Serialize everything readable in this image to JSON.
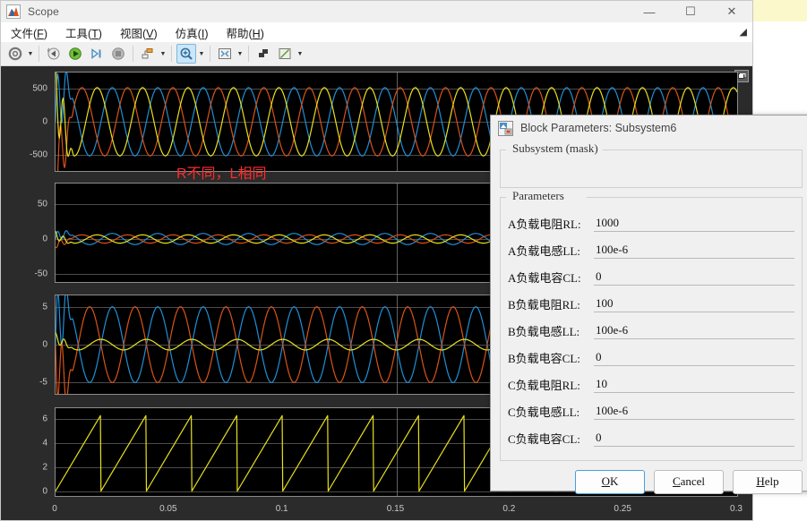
{
  "window": {
    "title": "Scope",
    "icon": "scope-icon",
    "controls": {
      "minimize": "—",
      "maximize": "☐",
      "close": "✕"
    }
  },
  "menubar": {
    "items": [
      {
        "name": "file",
        "text": "文件(F)",
        "pre": "文件(",
        "mnemonic": "F",
        "post": ")"
      },
      {
        "name": "tools",
        "text": "工具(T)",
        "pre": "工具(",
        "mnemonic": "T",
        "post": ")"
      },
      {
        "name": "view",
        "text": "视图(V)",
        "pre": "视图(",
        "mnemonic": "V",
        "post": ")"
      },
      {
        "name": "simulation",
        "text": "仿真(I)",
        "pre": "仿真(",
        "mnemonic": "I",
        "post": ")"
      },
      {
        "name": "help",
        "text": "帮助(H)",
        "pre": "帮助(",
        "mnemonic": "H",
        "post": ")"
      }
    ],
    "overflow": "◢"
  },
  "toolbar": {
    "buttons": [
      {
        "name": "configuration-properties-icon",
        "glyph": "gear",
        "dropdown": true,
        "active": false
      },
      {
        "name": "run-back-icon",
        "glyph": "runback",
        "dropdown": false,
        "active": false
      },
      {
        "name": "run-icon",
        "glyph": "play",
        "dropdown": false,
        "active": false
      },
      {
        "name": "step-forward-icon",
        "glyph": "step",
        "dropdown": false,
        "active": false
      },
      {
        "name": "stop-icon",
        "glyph": "stop",
        "dropdown": false,
        "active": false
      },
      {
        "name": "layout-icon",
        "glyph": "layout",
        "dropdown": true,
        "active": false
      },
      {
        "name": "zoom-in-icon",
        "glyph": "zoomin",
        "dropdown": true,
        "active": true
      },
      {
        "name": "fit-to-view-icon",
        "glyph": "fit",
        "dropdown": true,
        "active": false
      },
      {
        "name": "trigger-icon",
        "glyph": "trigger",
        "dropdown": false,
        "active": false
      },
      {
        "name": "measurements-icon",
        "glyph": "measure",
        "dropdown": true,
        "active": false
      }
    ]
  },
  "chart_data": {
    "type": "line",
    "title": "",
    "xlabel": "",
    "x_ticks": [
      "0",
      "0.05",
      "0.1",
      "0.15",
      "0.2",
      "0.25",
      "0.3"
    ],
    "xlim": [
      0,
      0.3
    ],
    "grid": true,
    "legend": "none",
    "series_colors": {
      "phase_a": "#1f8fd6",
      "phase_b": "#d95319",
      "phase_c": "#e8e01f"
    },
    "subplots": [
      {
        "name": "subplot-voltage",
        "ylabel": "",
        "y_ticks": [
          "500",
          "0",
          "-500"
        ],
        "ylim": [
          -750,
          750
        ],
        "series": [
          {
            "name": "phase_a",
            "color": "#1f8fd6",
            "amplitude": 520,
            "phase_deg": 0,
            "freq_hz": 50
          },
          {
            "name": "phase_b",
            "color": "#d95319",
            "amplitude": 520,
            "phase_deg": -120,
            "freq_hz": 50
          },
          {
            "name": "phase_c",
            "color": "#e8e01f",
            "amplitude": 520,
            "phase_deg": 120,
            "freq_hz": 50
          }
        ]
      },
      {
        "name": "subplot-current-small",
        "ylabel": "",
        "y_ticks": [
          "50",
          "0",
          "-50"
        ],
        "ylim": [
          -62,
          80
        ],
        "series": [
          {
            "name": "phase_a",
            "color": "#1f8fd6",
            "amplitude": 8,
            "phase_deg": 0,
            "freq_hz": 50
          },
          {
            "name": "phase_b",
            "color": "#d95319",
            "amplitude": 6,
            "phase_deg": -120,
            "freq_hz": 50
          },
          {
            "name": "phase_c",
            "color": "#e8e01f",
            "amplitude": 6,
            "phase_deg": 120,
            "freq_hz": 50
          }
        ]
      },
      {
        "name": "subplot-current-large",
        "ylabel": "",
        "y_ticks": [
          "5",
          "0",
          "-5"
        ],
        "ylim": [
          -6.5,
          6.5
        ],
        "series": [
          {
            "name": "phase_a",
            "color": "#1f8fd6",
            "amplitude": 5,
            "phase_deg": 0,
            "freq_hz": 50
          },
          {
            "name": "phase_b",
            "color": "#d95319",
            "amplitude": 5,
            "phase_deg": 180,
            "freq_hz": 50
          },
          {
            "name": "phase_c",
            "color": "#e8e01f",
            "amplitude": 0.7,
            "phase_deg": 90,
            "freq_hz": 50
          }
        ]
      },
      {
        "name": "subplot-sawtooth",
        "ylabel": "",
        "y_ticks": [
          "6",
          "4",
          "2",
          "0"
        ],
        "ylim": [
          -0.4,
          6.9
        ],
        "series": [
          {
            "name": "ramp",
            "color": "#e8e01f",
            "waveform": "sawtooth",
            "peak": 6.283,
            "period_s": 0.02
          }
        ]
      }
    ]
  },
  "dialog": {
    "icon": "block-parameters-icon",
    "title": "Block Parameters: Subsystem6",
    "mask_group_label": "Subsystem  (mask)",
    "params_group_label": "Parameters",
    "params": [
      {
        "name": "a-load-resistance",
        "label": "A负载电阻RL:",
        "value": "1000"
      },
      {
        "name": "a-load-inductance",
        "label": "A负载电感LL:",
        "value": "100e-6"
      },
      {
        "name": "a-load-capacitance",
        "label": "A负载电容CL:",
        "value": "0"
      },
      {
        "name": "b-load-resistance",
        "label": "B负载电阻RL:",
        "value": "100"
      },
      {
        "name": "b-load-inductance",
        "label": "B负载电感LL:",
        "value": "100e-6"
      },
      {
        "name": "b-load-capacitance",
        "label": "B负载电容CL:",
        "value": "0"
      },
      {
        "name": "c-load-resistance",
        "label": "C负载电阻RL:",
        "value": "10"
      },
      {
        "name": "c-load-inductance",
        "label": "C负载电感LL:",
        "value": "100e-6"
      },
      {
        "name": "c-load-capacitance",
        "label": "C负载电容CL:",
        "value": "0"
      }
    ],
    "buttons": [
      {
        "name": "ok-button",
        "pre": "",
        "mnemonic": "O",
        "post": "K",
        "primary": true
      },
      {
        "name": "cancel-button",
        "pre": "",
        "mnemonic": "C",
        "post": "ancel",
        "primary": false
      },
      {
        "name": "help-button",
        "pre": "",
        "mnemonic": "H",
        "post": "elp",
        "primary": false
      }
    ]
  },
  "annotation": {
    "text": "R不同，L相同",
    "color": "#ff2a2a"
  }
}
